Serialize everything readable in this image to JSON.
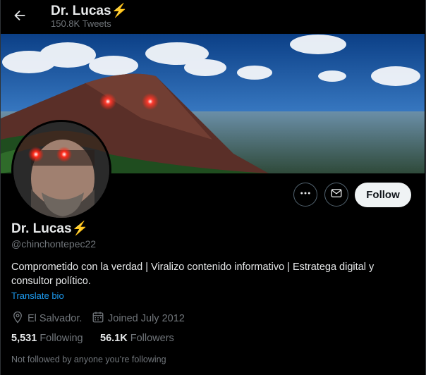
{
  "header": {
    "name": "Dr. Lucas⚡",
    "tweet_count": "150.8K Tweets"
  },
  "profile": {
    "name": "Dr. Lucas⚡",
    "handle": "@chinchontepec22",
    "bio": "Comprometido con la verdad | Viralizo contenido informativo | Estratega digital y consultor político.",
    "translate_label": "Translate bio",
    "location": "El Salvador.",
    "joined": "Joined July 2012",
    "following_count": "5,531",
    "following_label": "Following",
    "followers_count": "56.1K",
    "followers_label": "Followers",
    "not_followed_text": "Not followed by anyone you’re following"
  },
  "actions": {
    "follow_label": "Follow",
    "more_icon": "more-icon",
    "message_icon": "envelope-icon"
  },
  "colors": {
    "accent": "#1d9bf0",
    "background": "#000000",
    "secondary_text": "#71767b"
  }
}
